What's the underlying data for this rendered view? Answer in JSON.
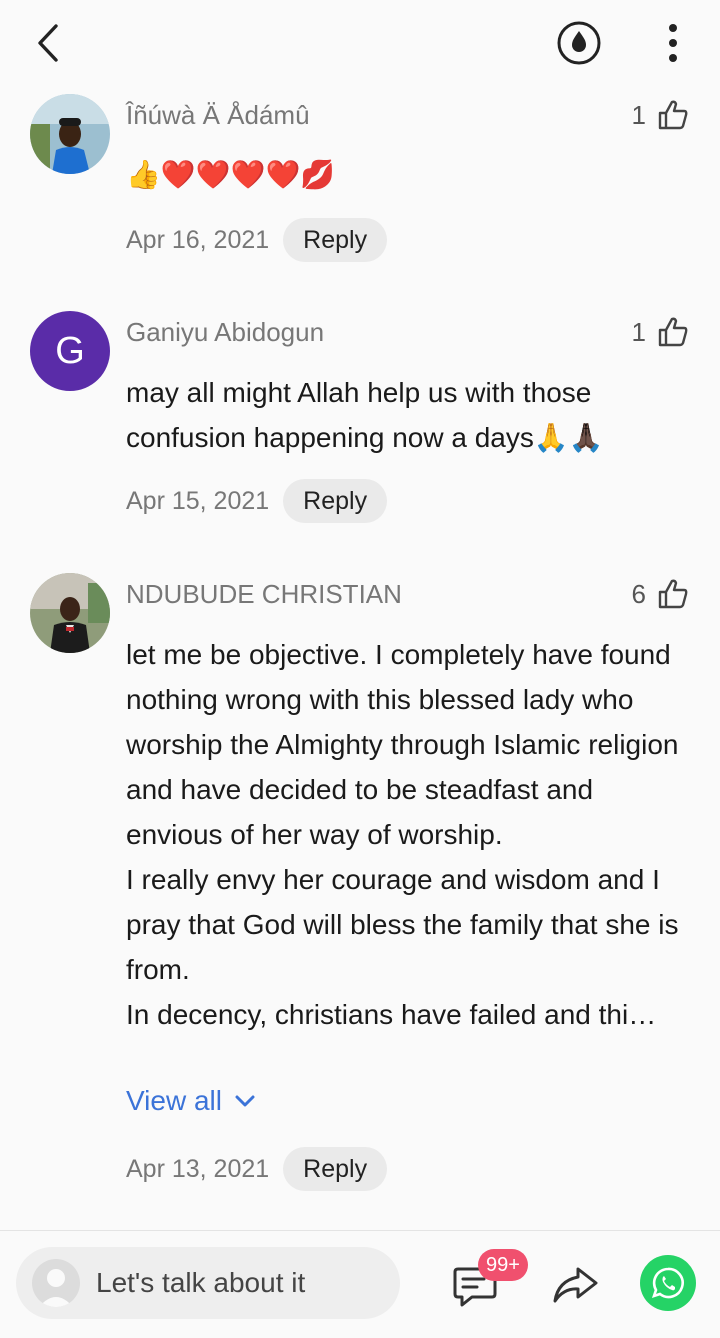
{
  "header": {
    "back_icon": "chevron-left-icon",
    "theme_icon": "water-drop-icon",
    "more_icon": "more-vertical-icon"
  },
  "comments": [
    {
      "author": "Îñúwà Ä Ådámû",
      "likes": "1",
      "body": [
        "👍❤️❤️❤️❤️💋"
      ],
      "date": "Apr 16, 2021",
      "reply_label": "Reply"
    },
    {
      "author": "Ganiyu Abidogun",
      "avatar_letter": "G",
      "likes": "1",
      "body": [
        "may all might Allah help us with those confusion happening now a days🙏🙏🏿"
      ],
      "date": "Apr 15, 2021",
      "reply_label": "Reply"
    },
    {
      "author": "NDUBUDE CHRISTIAN",
      "likes": "6",
      "body": [
        "let me be objective. I completely have found nothing wrong with this blessed lady who worship the Almighty through Islamic religion and have decided to be steadfast and envious of her way of worship.",
        "I really envy her courage and wisdom and I pray that God will bless the family that she is from.",
        "In decency, christians have failed and thi…"
      ],
      "view_all_label": "View all",
      "date": "Apr 13, 2021",
      "reply_label": "Reply"
    }
  ],
  "footer": {
    "input_placeholder": "Let's talk about it",
    "comment_badge": "99+",
    "colors": {
      "accent": "#3b73d8",
      "badge": "#f0506e",
      "whatsapp": "#25d366",
      "avatar_g": "#5a2ca8"
    }
  }
}
